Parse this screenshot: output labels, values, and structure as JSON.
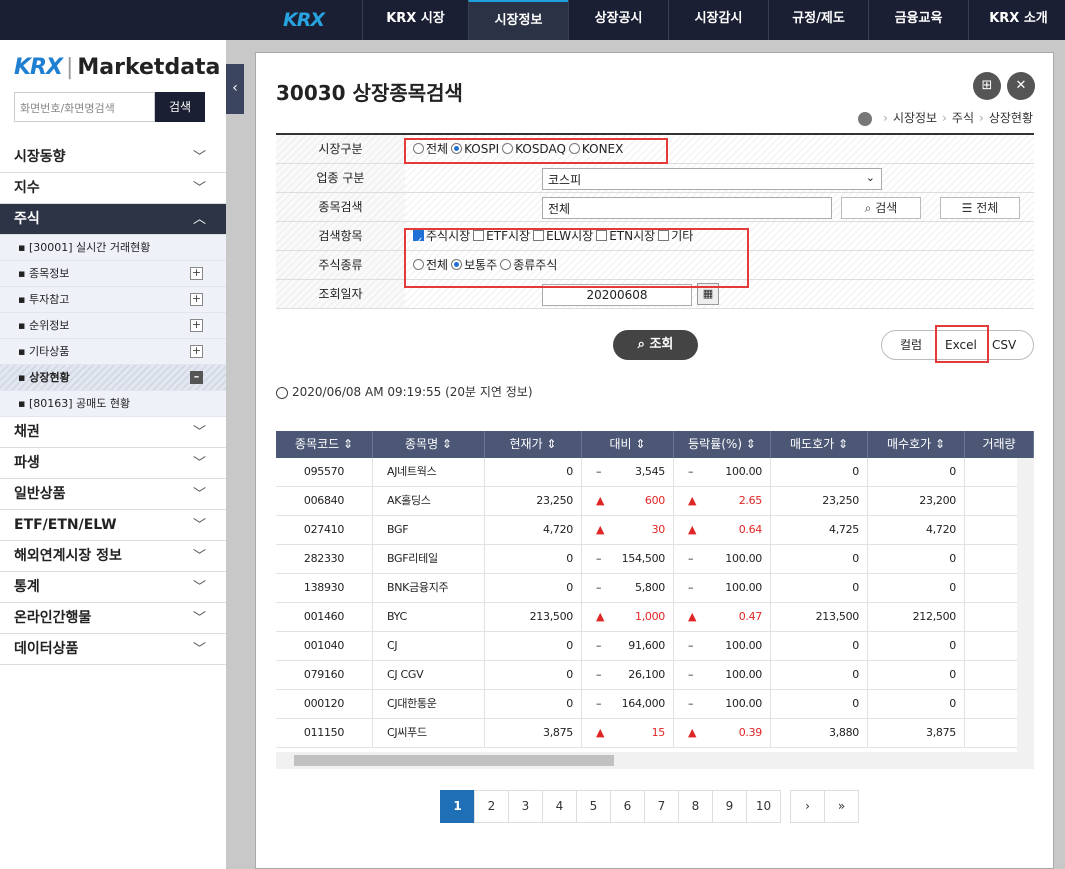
{
  "topnav": {
    "logo": "KRX",
    "items": [
      "KRX 시장",
      "시장정보",
      "상장공시",
      "시장감시",
      "규정/제도",
      "금융교육",
      "KRX 소개"
    ],
    "active_index": 1
  },
  "sidebar": {
    "brand_logo": "KRX",
    "brand_name": "Marketdata",
    "search_placeholder": "화면번호/화면명검색",
    "search_button": "검색",
    "menu": [
      {
        "label": "시장동향"
      },
      {
        "label": "지수"
      },
      {
        "label": "주식",
        "open": true,
        "sub": [
          {
            "label": "[30001] 실시간 거래현황"
          },
          {
            "label": "종목정보",
            "plus": true
          },
          {
            "label": "투자참고",
            "plus": true
          },
          {
            "label": "순위정보",
            "plus": true
          },
          {
            "label": "기타상품",
            "plus": true
          },
          {
            "label": "상장현황",
            "active": true
          },
          {
            "label": "[80163] 공매도 현황"
          }
        ]
      },
      {
        "label": "채권"
      },
      {
        "label": "파생"
      },
      {
        "label": "일반상품"
      },
      {
        "label": "ETF/ETN/ELW"
      },
      {
        "label": "해외연계시장 정보"
      },
      {
        "label": "통계"
      },
      {
        "label": "온라인간행물"
      },
      {
        "label": "데이터상품"
      }
    ]
  },
  "page": {
    "title": "30030 상장종목검색",
    "breadcrumb": [
      "시장정보",
      "주식",
      "상장현황"
    ],
    "form": {
      "market_label": "시장구분",
      "market_options": [
        "전체",
        "KOSPI",
        "KOSDAQ",
        "KONEX"
      ],
      "market_selected": 1,
      "industry_label": "업종 구분",
      "industry_value": "코스피",
      "stock_label": "종목검색",
      "stock_value": "전체",
      "search_btn": "검색",
      "all_btn": "☰ 전체",
      "items_label": "검색항목",
      "items_options": [
        "주식시장",
        "ETF시장",
        "ELW시장",
        "ETN시장",
        "기타"
      ],
      "items_checked": [
        0
      ],
      "type_label": "주식종류",
      "type_options": [
        "전체",
        "보통주",
        "종류주식"
      ],
      "type_selected": 1,
      "date_label": "조회일자",
      "date_value": "20200608"
    },
    "query_btn": "조회",
    "export": {
      "column": "컬럼",
      "excel": "Excel",
      "csv": "CSV"
    },
    "timestamp": "2020/06/08 AM 09:19:55 (20분 지연 정보)",
    "columns": [
      "종목코드 ⇕",
      "종목명 ⇕",
      "현재가 ⇕",
      "대비 ⇕",
      "등락률(%) ⇕",
      "매도호가 ⇕",
      "매수호가 ⇕",
      "거래량"
    ],
    "rows": [
      {
        "code": "095570",
        "name": "AJ네트웍스",
        "price": "0",
        "chg_sign": "–",
        "chg": "3,545",
        "rate_sign": "–",
        "rate": "100.00",
        "ask": "0",
        "bid": "0",
        "up": false
      },
      {
        "code": "006840",
        "name": "AK홀딩스",
        "price": "23,250",
        "chg_sign": "▲",
        "chg": "600",
        "rate_sign": "▲",
        "rate": "2.65",
        "ask": "23,250",
        "bid": "23,200",
        "up": true
      },
      {
        "code": "027410",
        "name": "BGF",
        "price": "4,720",
        "chg_sign": "▲",
        "chg": "30",
        "rate_sign": "▲",
        "rate": "0.64",
        "ask": "4,725",
        "bid": "4,720",
        "up": true
      },
      {
        "code": "282330",
        "name": "BGF리테일",
        "price": "0",
        "chg_sign": "–",
        "chg": "154,500",
        "rate_sign": "–",
        "rate": "100.00",
        "ask": "0",
        "bid": "0",
        "up": false
      },
      {
        "code": "138930",
        "name": "BNK금융지주",
        "price": "0",
        "chg_sign": "–",
        "chg": "5,800",
        "rate_sign": "–",
        "rate": "100.00",
        "ask": "0",
        "bid": "0",
        "up": false
      },
      {
        "code": "001460",
        "name": "BYC",
        "price": "213,500",
        "chg_sign": "▲",
        "chg": "1,000",
        "rate_sign": "▲",
        "rate": "0.47",
        "ask": "213,500",
        "bid": "212,500",
        "up": true
      },
      {
        "code": "001040",
        "name": "CJ",
        "price": "0",
        "chg_sign": "–",
        "chg": "91,600",
        "rate_sign": "–",
        "rate": "100.00",
        "ask": "0",
        "bid": "0",
        "up": false
      },
      {
        "code": "079160",
        "name": "CJ CGV",
        "price": "0",
        "chg_sign": "–",
        "chg": "26,100",
        "rate_sign": "–",
        "rate": "100.00",
        "ask": "0",
        "bid": "0",
        "up": false
      },
      {
        "code": "000120",
        "name": "CJ대한통운",
        "price": "0",
        "chg_sign": "–",
        "chg": "164,000",
        "rate_sign": "–",
        "rate": "100.00",
        "ask": "0",
        "bid": "0",
        "up": false
      },
      {
        "code": "011150",
        "name": "CJ씨푸드",
        "price": "3,875",
        "chg_sign": "▲",
        "chg": "15",
        "rate_sign": "▲",
        "rate": "0.39",
        "ask": "3,880",
        "bid": "3,875",
        "up": true
      }
    ],
    "pages": [
      "1",
      "2",
      "3",
      "4",
      "5",
      "6",
      "7",
      "8",
      "9",
      "10"
    ],
    "current_page": "1",
    "next": "›",
    "last": "»"
  }
}
